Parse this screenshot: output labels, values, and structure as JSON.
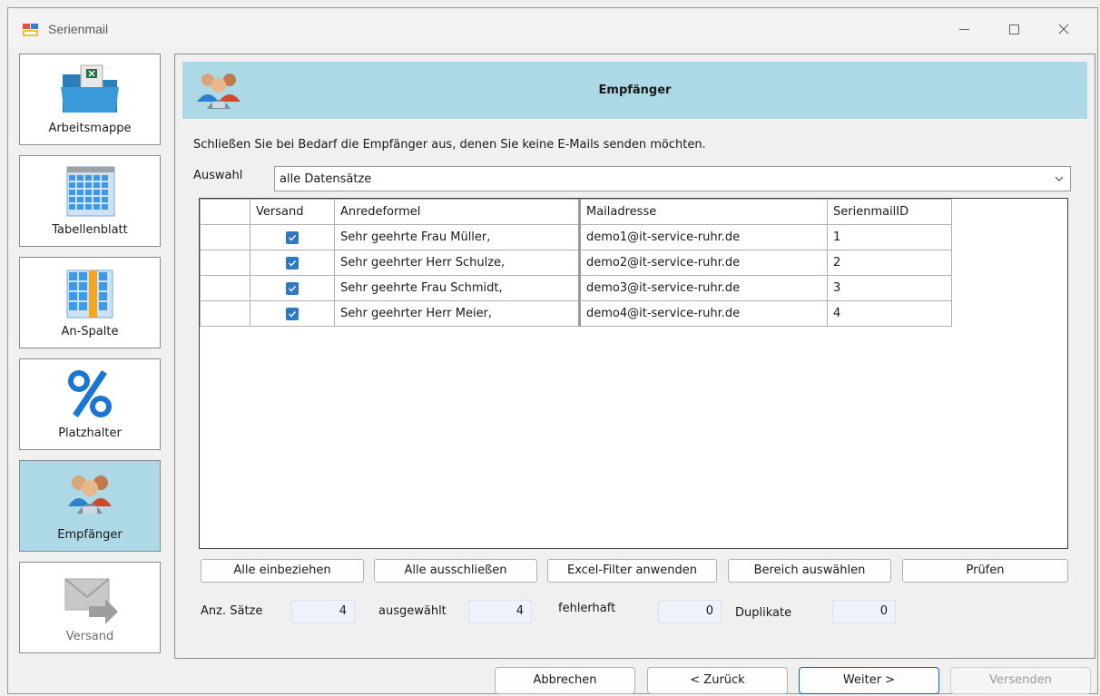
{
  "window": {
    "title": "Serienmail"
  },
  "sidebar": {
    "items": [
      {
        "label": "Arbeitsmappe",
        "icon": "workbook-icon"
      },
      {
        "label": "Tabellenblatt",
        "icon": "worksheet-icon"
      },
      {
        "label": "An-Spalte",
        "icon": "column-icon"
      },
      {
        "label": "Platzhalter",
        "icon": "percent-icon"
      },
      {
        "label": "Empfänger",
        "icon": "people-icon",
        "active": true
      },
      {
        "label": "Versand",
        "icon": "envelope-arrow-icon",
        "disabled": true
      }
    ]
  },
  "header": {
    "title": "Empfänger"
  },
  "instruction": "Schließen Sie bei Bedarf die Empfänger aus, denen Sie keine E-Mails senden möchten.",
  "auswahl": {
    "label": "Auswahl",
    "value": "alle Datensätze"
  },
  "table": {
    "columns": [
      "Versand",
      "Anredeformel",
      "Mailadresse",
      "SerienmailID"
    ],
    "rows": [
      {
        "versand": true,
        "anrede": "Sehr geehrte Frau Müller,",
        "mail": "demo1@it-service-ruhr.de",
        "id": "1"
      },
      {
        "versand": true,
        "anrede": "Sehr geehrter Herr Schulze,",
        "mail": "demo2@it-service-ruhr.de",
        "id": "2"
      },
      {
        "versand": true,
        "anrede": "Sehr geehrte Frau Schmidt,",
        "mail": "demo3@it-service-ruhr.de",
        "id": "3"
      },
      {
        "versand": true,
        "anrede": "Sehr geehrter Herr Meier,",
        "mail": "demo4@it-service-ruhr.de",
        "id": "4"
      }
    ]
  },
  "actions": {
    "include_all": "Alle einbeziehen",
    "exclude_all": "Alle ausschließen",
    "excel_filter": "Excel-Filter anwenden",
    "select_range": "Bereich auswählen",
    "check": "Prüfen"
  },
  "stats": {
    "count_label": "Anz. Sätze",
    "count": "4",
    "selected_label": "ausgewählt",
    "selected": "4",
    "faulty_label": "fehlerhaft",
    "faulty": "0",
    "duplicates_label": "Duplikate",
    "duplicates": "0"
  },
  "footer": {
    "cancel": "Abbrechen",
    "back": "< Zurück",
    "next": "Weiter >",
    "send": "Versenden"
  },
  "colors": {
    "accent": "#add8e6",
    "checkbox": "#2f78c4",
    "primary_border": "#0067c0"
  }
}
